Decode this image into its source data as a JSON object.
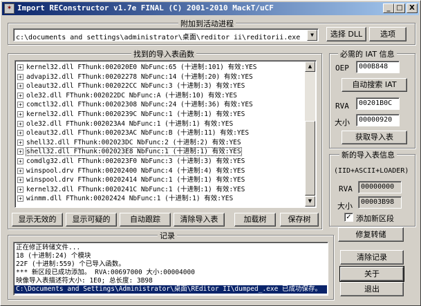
{
  "window": {
    "title": "Import REConstructor v1.7e FINAL (C) 2001-2010 MackT/uCF",
    "minimize": "_",
    "maximize": "□",
    "close": "X"
  },
  "attach": {
    "group_title": "附加到活动进程",
    "process_path": "c:\\documents and settings\\administrator\\桌面\\reditor ii\\reditorii.exe",
    "dropdown_arrow": "▼",
    "pick_dll_label": "选择 DLL",
    "options_label": "选项"
  },
  "imports": {
    "group_title": "找到的导入表函数",
    "rows": [
      "kernel32.dll FThunk:002020E0 NbFunc:65 (十进制:101) 有效:YES",
      "advapi32.dll FThunk:00202278 NbFunc:14 (十进制:20) 有效:YES",
      "oleaut32.dll FThunk:002022CC NbFunc:3 (十进制:3) 有效:YES",
      "ole32.dll FThunk:002022DC NbFunc:A (十进制:10) 有效:YES",
      "comctl32.dll FThunk:00202308 NbFunc:24 (十进制:36) 有效:YES",
      "kernel32.dll FThunk:0020239C NbFunc:1 (十进制:1) 有效:YES",
      "ole32.dll FThunk:002023A4 NbFunc:1 (十进制:1) 有效:YES",
      "oleaut32.dll FThunk:002023AC NbFunc:B (十进制:11) 有效:YES",
      "shell32.dll FThunk:002023DC NbFunc:2 (十进制:2) 有效:YES",
      "shell32.dll FThunk:002023E8 NbFunc:1 (十进制:1) 有效:YES",
      "comdlg32.dll FThunk:002023F0 NbFunc:3 (十进制:3) 有效:YES",
      "winspool.drv FThunk:00202400 NbFunc:4 (十进制:4) 有效:YES",
      "winspool.drv FThunk:00202414 NbFunc:1 (十进制:1) 有效:YES",
      "kernel32.dll FThunk:0020241C NbFunc:1 (十进制:1) 有效:YES",
      "winmm.dll FThunk:00202424 NbFunc:1 (十进制:1) 有效:YES"
    ],
    "selected_index": 9,
    "expander": "+",
    "buttons": {
      "show_invalid": "显示无效的",
      "show_suspect": "显示可疑的",
      "auto_trace": "自动跟踪",
      "clear_imports": "清除导入表",
      "load_tree": "加载树",
      "save_tree": "保存树"
    }
  },
  "iat": {
    "group_title": "必需的 IAT 信息",
    "oep_label": "OEP",
    "oep_value": "000B848",
    "auto_search_label": "自动搜索 IAT",
    "rva_label": "RVA",
    "rva_value": "00201B0C",
    "size_label": "大小",
    "size_value": "00000920",
    "get_imports_label": "获取导入表"
  },
  "new_import": {
    "group_title": "新的导入表信息",
    "subtitle": "(IID+ASCII+LOADER)",
    "rva_label": "RVA",
    "rva_value": "00000000",
    "size_label": "大小",
    "size_value": "00003B98",
    "add_section_label": "添加新区段",
    "add_section_checked": "✓",
    "fix_dump_label": "修复转储"
  },
  "log": {
    "group_title": "记录",
    "lines": [
      "正在修正转储文件...",
      "18 (十进制:24) 个模块",
      "22F (十进制:559) 个已导入函数。",
      "*** 新区段已成功添加。 RVA:00697000 大小:00004000",
      "映像导入表描述符大小: 1E0; 总长度: 3B98",
      "C:\\Documents and Settings\\Administrator\\桌面\\REditor II\\dumped_.exe 已成功保存。"
    ],
    "clear_log_label": "清除记录",
    "about_label": "关于",
    "exit_label": "退出"
  }
}
